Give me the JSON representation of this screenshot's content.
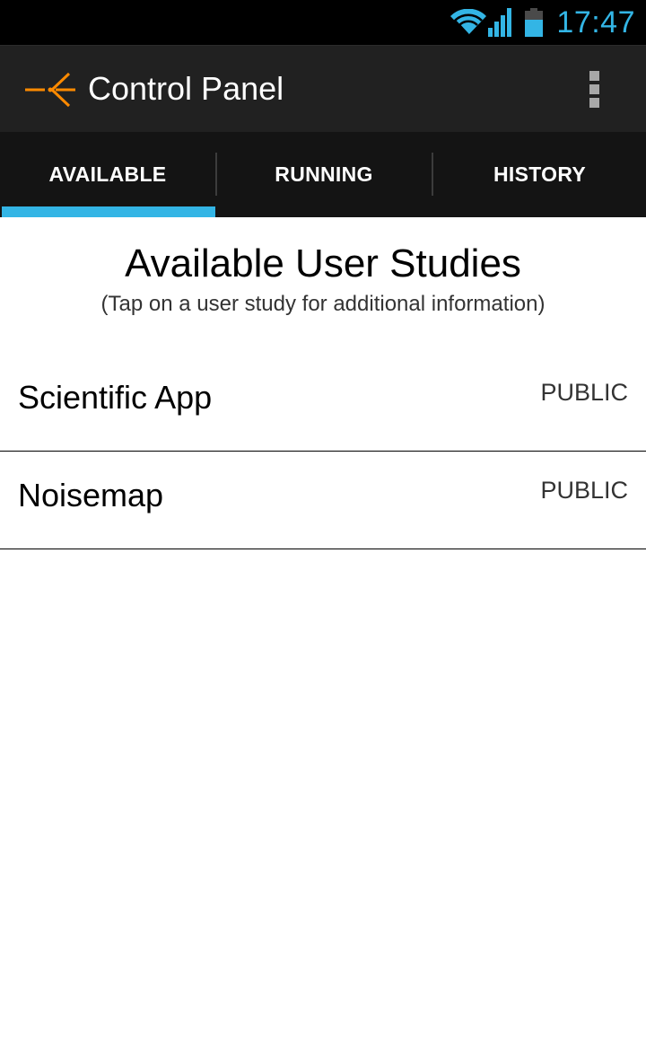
{
  "status_bar": {
    "time": "17:47",
    "accent_color": "#33b5e5",
    "icons": [
      "wifi-icon",
      "cell-signal-icon",
      "battery-icon"
    ]
  },
  "action_bar": {
    "title": "Control Panel",
    "app_icon": "antenna-logo-icon",
    "overflow_icon": "overflow-menu-icon",
    "logo_color": "#ff8a00"
  },
  "tabs": [
    {
      "label": "AVAILABLE",
      "selected": true
    },
    {
      "label": "RUNNING",
      "selected": false
    },
    {
      "label": "HISTORY",
      "selected": false
    }
  ],
  "content": {
    "title": "Available User Studies",
    "subtitle": "(Tap on a user study for additional information)",
    "studies": [
      {
        "name": "Scientific App",
        "access": "PUBLIC"
      },
      {
        "name": "Noisemap",
        "access": "PUBLIC"
      }
    ]
  }
}
